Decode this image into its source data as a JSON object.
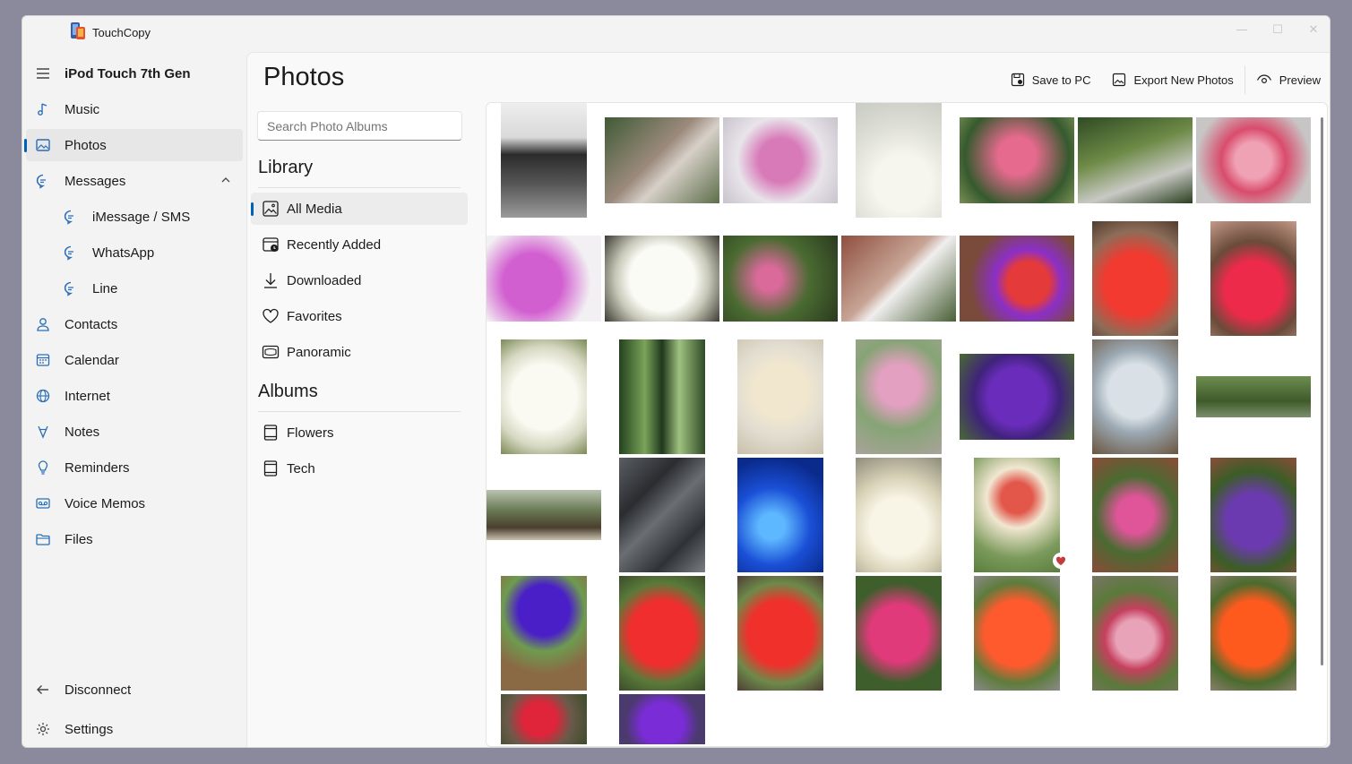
{
  "app": {
    "title": "TouchCopy"
  },
  "window_controls": {
    "minimize": "—",
    "maximize": "☐",
    "close": "✕"
  },
  "nav": {
    "device": "iPod Touch 7th Gen",
    "items": [
      {
        "label": "Music",
        "icon": "music-note-icon"
      },
      {
        "label": "Photos",
        "icon": "photo-icon",
        "selected": true
      },
      {
        "label": "Messages",
        "icon": "chat-bubble-icon",
        "expanded": true
      },
      {
        "label": "iMessage / SMS",
        "icon": "chat-bubble-icon",
        "sub": true
      },
      {
        "label": "WhatsApp",
        "icon": "chat-bubble-icon",
        "sub": true
      },
      {
        "label": "Line",
        "icon": "chat-bubble-icon",
        "sub": true
      },
      {
        "label": "Contacts",
        "icon": "person-icon"
      },
      {
        "label": "Calendar",
        "icon": "calendar-icon"
      },
      {
        "label": "Internet",
        "icon": "globe-icon"
      },
      {
        "label": "Notes",
        "icon": "notes-icon"
      },
      {
        "label": "Reminders",
        "icon": "reminder-icon"
      },
      {
        "label": "Voice Memos",
        "icon": "voice-memo-icon"
      },
      {
        "label": "Files",
        "icon": "folder-icon"
      }
    ],
    "disconnect": "Disconnect",
    "settings": "Settings"
  },
  "page": {
    "title": "Photos"
  },
  "toolbar": {
    "save": "Save to PC",
    "export": "Export New Photos",
    "preview": "Preview"
  },
  "albums_panel": {
    "search_placeholder": "Search Photo Albums",
    "library_heading": "Library",
    "library": [
      {
        "label": "All Media",
        "icon": "image-icon",
        "selected": true
      },
      {
        "label": "Recently Added",
        "icon": "recent-icon"
      },
      {
        "label": "Downloaded",
        "icon": "download-icon"
      },
      {
        "label": "Favorites",
        "icon": "heart-icon"
      },
      {
        "label": "Panoramic",
        "icon": "panorama-icon"
      }
    ],
    "albums_heading": "Albums",
    "albums": [
      {
        "label": "Flowers",
        "icon": "album-icon"
      },
      {
        "label": "Tech",
        "icon": "album-icon"
      }
    ]
  },
  "colors": {
    "accent": "#005fb8",
    "favorite": "#c43b3b"
  }
}
